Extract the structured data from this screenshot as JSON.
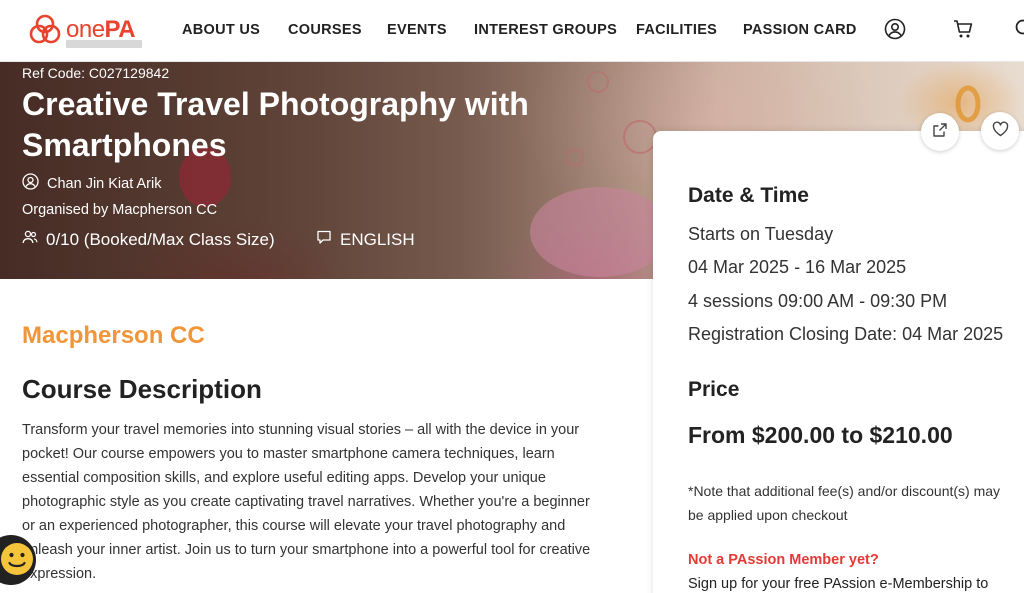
{
  "header": {
    "logo_text_one": "one",
    "logo_text_pa": "PA",
    "nav": [
      "ABOUT US",
      "COURSES",
      "EVENTS",
      "INTEREST GROUPS",
      "FACILITIES",
      "PASSION CARD"
    ]
  },
  "hero": {
    "ref_code": "Ref Code: C027129842",
    "title": "Creative Travel Photography with Smartphones",
    "instructor": "Chan Jin Kiat Arik",
    "organiser": "Organised by Macpherson CC",
    "class_size": "0/10 (Booked/Max Class Size)",
    "language": "ENGLISH"
  },
  "card": {
    "date_heading": "Date & Time",
    "starts_on": "Starts on Tuesday",
    "date_range": "04 Mar 2025 - 16 Mar 2025",
    "sessions": "4 sessions 09:00 AM - 09:30 PM",
    "closing": "Registration Closing Date: 04 Mar 2025",
    "price_heading": "Price",
    "price_value": "From $200.00 to $210.00",
    "note": "*Note that additional fee(s) and/or discount(s) may be applied upon checkout",
    "not_member": "Not a PAssion Member yet?",
    "signup": "Sign up for your free PAssion e-Membership to"
  },
  "main": {
    "org_name": "Macpherson CC",
    "desc_title": "Course Description",
    "desc_body": "Transform your travel memories into stunning visual stories – all with the device in your pocket! Our course empowers you to master smartphone camera techniques, learn essential composition skills, and explore useful editing apps. Develop your unique photographic style as you create captivating travel narratives. Whether you're a beginner or an experienced photographer, this course will elevate your travel photography and unleash your inner artist. Join us to turn your smartphone into a powerful tool for creative expression."
  },
  "colors": {
    "brand_red": "#e8432c",
    "org_orange": "#f0963a",
    "alert_red": "#e53935"
  },
  "icons": [
    "logo-mark-icon",
    "user-account-icon",
    "cart-icon",
    "search-icon",
    "share-icon",
    "heart-icon",
    "person-icon",
    "people-icon",
    "speech-bubble-icon",
    "smiley-icon"
  ]
}
